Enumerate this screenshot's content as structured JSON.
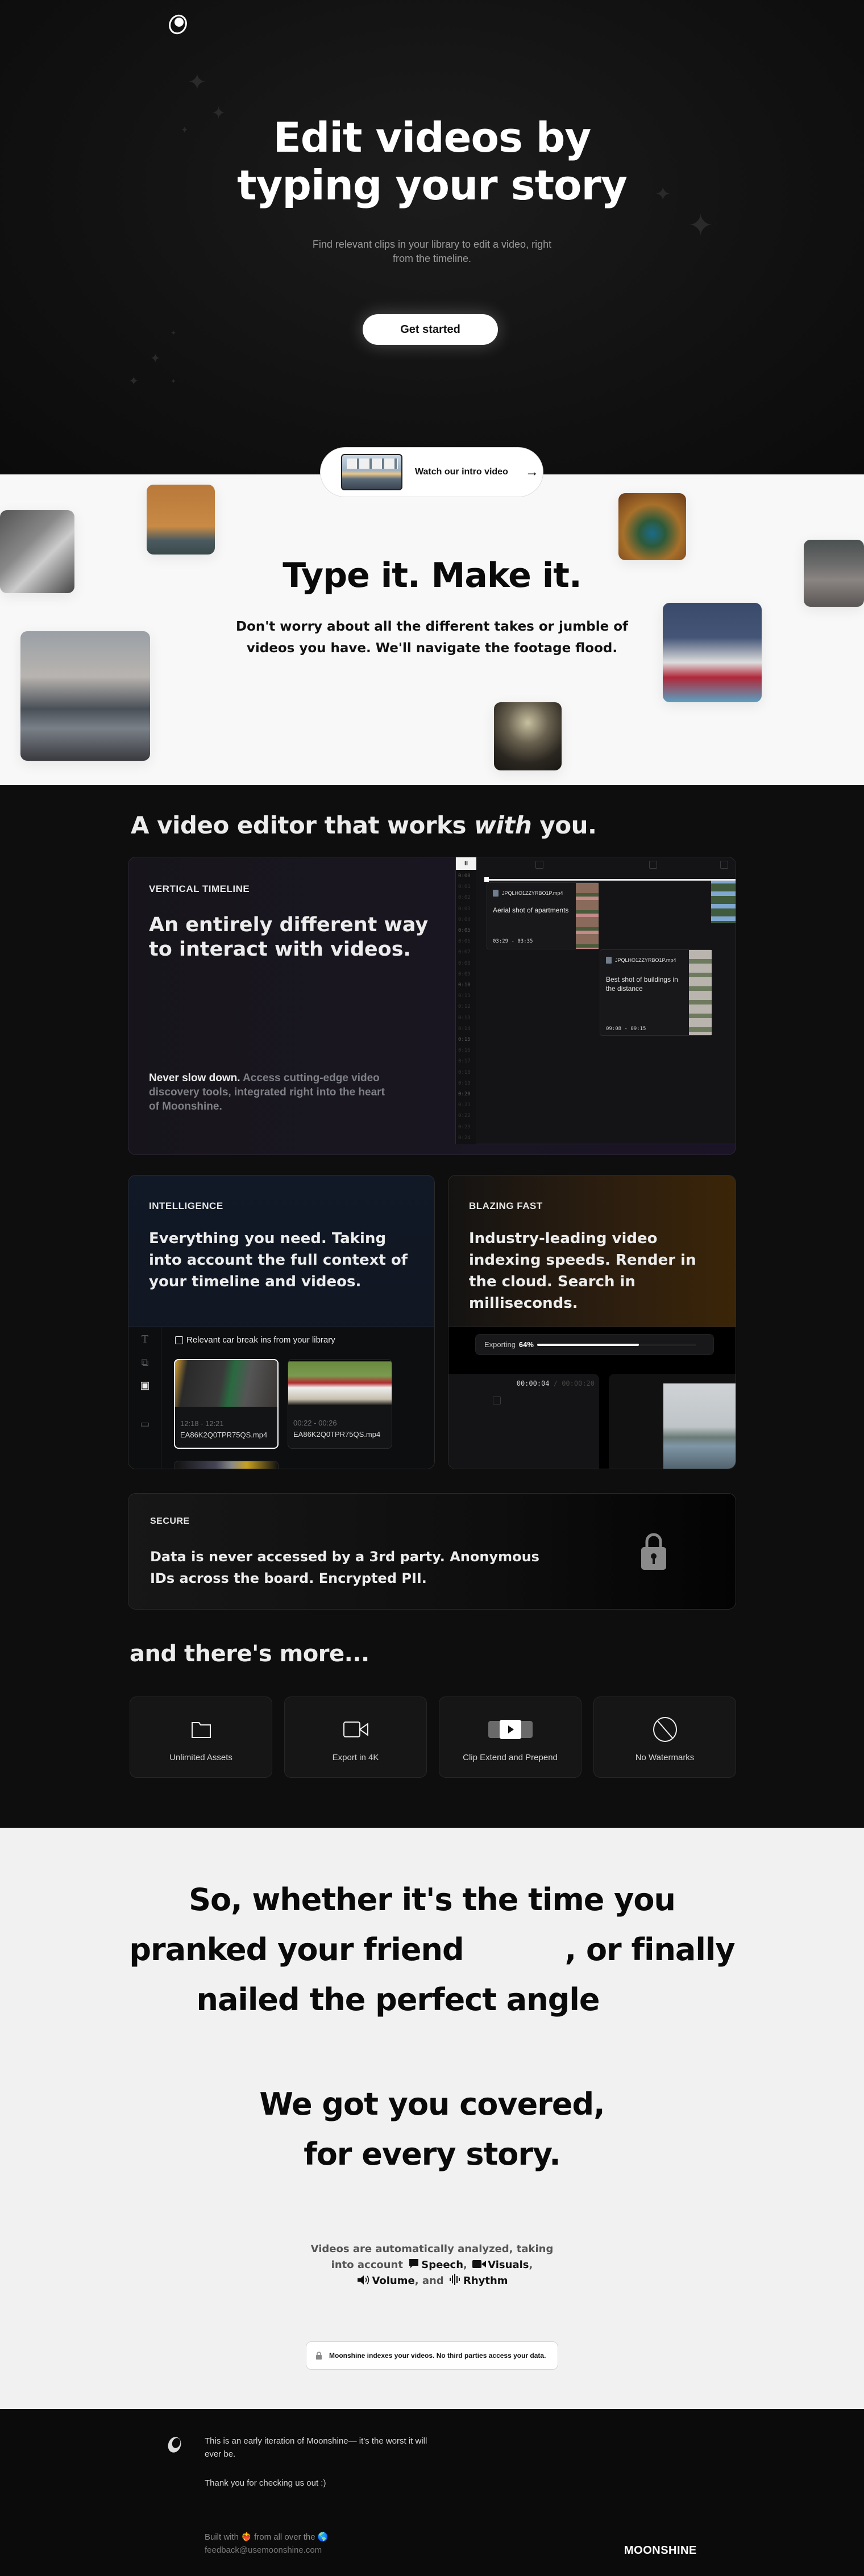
{
  "hero": {
    "logo_icon": "moon-logo-icon",
    "title_line1": "Edit videos by",
    "title_line2": "typing your story",
    "subtitle": "Find relevant clips in your library to edit a video, right from the timeline.",
    "cta_label": "Get started"
  },
  "intro_video": {
    "label": "Watch our intro video",
    "arrow": "→"
  },
  "showcase": {
    "title": "Type it. Make it.",
    "subtitle": "Don't worry about all the different takes or jumble of videos you have. We'll navigate the footage flood."
  },
  "features": {
    "title_before": "A video editor that works ",
    "title_em": "with",
    "title_after": " you.",
    "timeline_card": {
      "eyebrow": "VERTICAL TIMELINE",
      "headline": "An entirely different way to interact with videos.",
      "footer_bold": "Never slow down.",
      "footer_rest": " Access cutting-edge video discovery tools, integrated right into the heart of Moonshine.",
      "pause_icon": "II",
      "ticks": [
        "0:00",
        "0:01",
        "0:02",
        "0:03",
        "0:04",
        "0:05",
        "0:06",
        "0:07",
        "0:08",
        "0:09",
        "0:10",
        "0:11",
        "0:12",
        "0:13",
        "0:14",
        "0:15",
        "0:16",
        "0:17",
        "0:18",
        "0:19",
        "0:20",
        "0:21",
        "0:22",
        "0:23",
        "0:24"
      ],
      "clips": [
        {
          "file": "JPQLHO1ZZYRBO1P.mp4",
          "description": "Aerial shot of apartments",
          "range": "03:29 - 03:35"
        },
        {
          "file": "JPQLHO1ZZYRBO1P.mp4",
          "description": "Best shot of buildings in the distance",
          "range": "09:08 - 09:15"
        }
      ]
    },
    "intelligence_card": {
      "eyebrow": "INTELLIGENCE",
      "headline": "Everything you need. Taking into account the full context of your timeline and videos.",
      "query": "Relevant car break ins from your library",
      "results": [
        {
          "range": "12:18 - 12:21",
          "file": "EA86K2Q0TPR75QS.mp4",
          "selected": true
        },
        {
          "range": "00:22 - 00:26",
          "file": "EA86K2Q0TPR75QS.mp4",
          "selected": false
        }
      ]
    },
    "fast_card": {
      "eyebrow": "BLAZING FAST",
      "headline": "Industry-leading video indexing speeds. Render in the cloud. Search in milliseconds.",
      "export_label": "Exporting",
      "export_percent_label": "64%",
      "export_progress": 0.64,
      "timecode_current": "00:00:04",
      "timecode_sep": " / ",
      "timecode_total": "00:00:20"
    },
    "secure_card": {
      "eyebrow": "SECURE",
      "text": "Data is never accessed by a 3rd party. Anonymous IDs across the board. Encrypted PII."
    }
  },
  "more": {
    "title": "and there's more...",
    "perks": [
      {
        "icon": "folder-icon",
        "label": "Unlimited Assets"
      },
      {
        "icon": "video-camera-icon",
        "label": "Export in 4K"
      },
      {
        "icon": "clip-extend-icon",
        "label": "Clip Extend and Prepend"
      },
      {
        "icon": "no-watermark-icon",
        "label": "No Watermarks"
      }
    ]
  },
  "story": {
    "line1": "So, whether it's the time you",
    "line2": "pranked your friend          , or finally",
    "line3": "nailed the perfect angle",
    "covered1": "We got you covered,",
    "covered2": "for every story.",
    "analysis_prefix": "Videos are automatically analyzed, taking into account",
    "speech": "Speech",
    "visuals": "Visuals",
    "volume": "Volume",
    "and": ", and",
    "rhythm": "Rhythm",
    "privacy_note": "Moonshine indexes your videos. No third parties access your data."
  },
  "footer": {
    "line1": "This is an early iteration of Moonshine— it's the worst it will ever be.",
    "line2": "Thank you for checking us out :)",
    "built_prefix": "Built with",
    "built_heart": "❤️‍🔥",
    "built_mid": "from all over the",
    "built_globe": "🌎",
    "email": "feedback@usemoonshine.com",
    "wordmark": "MOONSHINE"
  }
}
